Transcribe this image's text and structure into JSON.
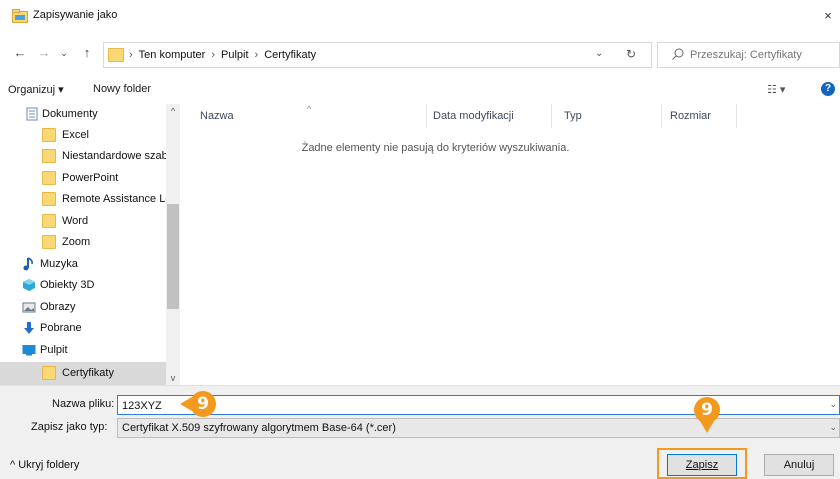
{
  "window": {
    "title": "Zapisywanie jako",
    "close_glyph": "×"
  },
  "address": {
    "crumbs": [
      "Ten komputer",
      "Pulpit",
      "Certyfikaty"
    ],
    "search_placeholder": "Przeszukaj: Certyfikaty"
  },
  "toolbar": {
    "organize": "Organizuj ▾",
    "new_folder": "Nowy folder",
    "help": "?"
  },
  "nav": {
    "items": [
      {
        "label": "Dokumenty",
        "icon": "documents-icon"
      },
      {
        "label": "Excel",
        "icon": "folder-icon"
      },
      {
        "label": "Niestandardowe szablo",
        "icon": "folder-icon"
      },
      {
        "label": "PowerPoint",
        "icon": "folder-icon"
      },
      {
        "label": "Remote Assistance Log",
        "icon": "folder-icon"
      },
      {
        "label": "Word",
        "icon": "folder-icon"
      },
      {
        "label": "Zoom",
        "icon": "folder-icon"
      },
      {
        "label": "Muzyka",
        "icon": "music-icon"
      },
      {
        "label": "Obiekty 3D",
        "icon": "3d-objects-icon"
      },
      {
        "label": "Obrazy",
        "icon": "pictures-icon"
      },
      {
        "label": "Pobrane",
        "icon": "downloads-icon"
      },
      {
        "label": "Pulpit",
        "icon": "desktop-icon"
      },
      {
        "label": "Certyfikaty",
        "icon": "folder-icon"
      }
    ],
    "selected": "Certyfikaty"
  },
  "files": {
    "columns": [
      "Nazwa",
      "Data modyfikacji",
      "Typ",
      "Rozmiar"
    ],
    "empty_message": "Żadne elementy nie pasują do kryteriów wyszukiwania."
  },
  "form": {
    "filename_label": "Nazwa pliku:",
    "filename_value": "123XYZ",
    "type_label": "Zapisz jako typ:",
    "type_value": "Certyfikat X.509 szyfrowany algorytmem Base-64 (*.cer)",
    "hide_folders": "^ Ukryj foldery",
    "save": "Zapisz",
    "cancel": "Anuluj"
  },
  "annotations": {
    "step": "9",
    "accent": "#f39a1e"
  }
}
